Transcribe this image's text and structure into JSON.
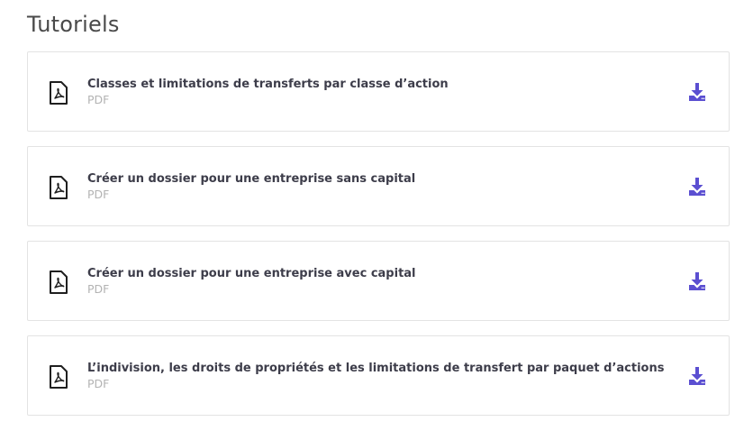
{
  "section": {
    "title": "Tutoriels"
  },
  "documents": [
    {
      "title": "Classes et limitations de transferts par classe d’action",
      "type": "PDF"
    },
    {
      "title": "Créer un dossier pour une entreprise sans capital",
      "type": "PDF"
    },
    {
      "title": "Créer un dossier pour une entreprise avec capital",
      "type": "PDF"
    },
    {
      "title": "L’indivision, les droits de propriétés et les limitations de transfert par paquet d’actions",
      "type": "PDF"
    }
  ],
  "icons": {
    "file": "pdf-file-icon",
    "download": "download-icon"
  },
  "colors": {
    "accent": "#5b4fd1",
    "title_text": "#3d3d4a",
    "muted_text": "#b3b3b3",
    "border": "#e3e3e3"
  }
}
